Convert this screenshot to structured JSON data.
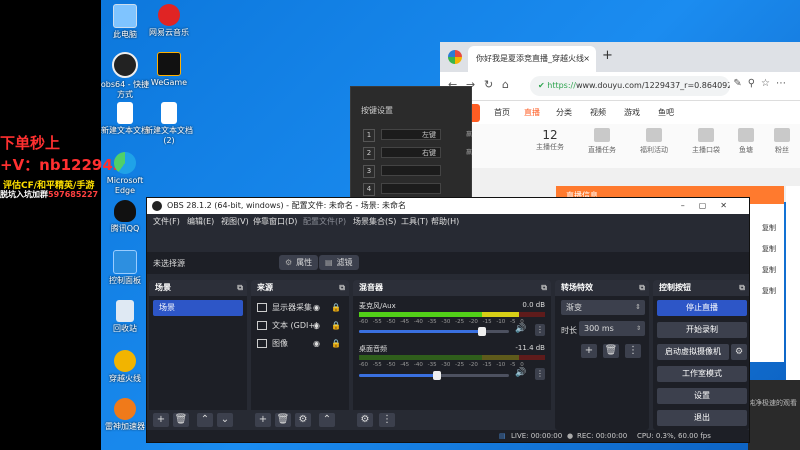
{
  "overlay": {
    "line1": "下单秒上",
    "line2": "+V：nb122943",
    "line3": "评估CF/和平精英/手游",
    "line4_a": "脱坑入坑加群",
    "line4_b": "597685227"
  },
  "desktop_icons": [
    {
      "label": "此电脑",
      "icon": "computer-icon"
    },
    {
      "label": "网易云音乐",
      "icon": "netease-music-icon"
    },
    {
      "label": "obs64 - 快捷方式",
      "icon": "obs-icon"
    },
    {
      "label": "WeGame",
      "icon": "wegame-icon"
    },
    {
      "label": "新建文本文档",
      "icon": "text-file-icon"
    },
    {
      "label": "新建文本文档 (2)",
      "icon": "text-file-icon"
    },
    {
      "label": "Microsoft Edge",
      "icon": "edge-icon"
    },
    {
      "label": "腾讯QQ",
      "icon": "qq-icon"
    },
    {
      "label": "控制面板",
      "icon": "control-panel-icon"
    },
    {
      "label": "回收站",
      "icon": "recycle-bin-icon"
    },
    {
      "label": "穿越火线",
      "icon": "crossfire-icon"
    },
    {
      "label": "雷神加速器",
      "icon": "leishen-icon"
    }
  ],
  "browser": {
    "tab_title": "你好我是夏添竞直播_穿越火线",
    "url_secure": "https://",
    "url_rest": "www.douyu.com/1229437_r=0.86409230",
    "site_logo": "斗鱼",
    "site_nav": [
      "首页",
      "直播",
      "分类",
      "视频",
      "游戏",
      "鱼吧"
    ],
    "active_nav": "直播",
    "icons": [
      {
        "label": "主播任务",
        "num": "12"
      },
      {
        "label": "直播任务",
        "num": ""
      },
      {
        "label": "福利活动",
        "num": ""
      },
      {
        "label": "主播口袋",
        "num": ""
      },
      {
        "label": "鱼塘",
        "num": ""
      },
      {
        "label": "粉丝",
        "num": ""
      }
    ],
    "popup_title": "直播信息",
    "popup_side": [
      "复制",
      "复制",
      "复制",
      "复制"
    ]
  },
  "bottom_right_text": "纯净极速的观看",
  "hotkey_dialog": {
    "title": "按键设置",
    "rows": [
      {
        "num": "1",
        "key": "左键",
        "side": "赢"
      },
      {
        "num": "2",
        "key": "右键",
        "side": "赢"
      },
      {
        "num": "3",
        "key": "",
        "side": ""
      },
      {
        "num": "4",
        "key": "",
        "side": ""
      }
    ]
  },
  "obs": {
    "title": "OBS 28.1.2 (64-bit, windows) - 配置文件: 未命名 - 场景: 未命名",
    "menu": [
      "文件(F)",
      "编辑(E)",
      "视图(V)",
      "停靠窗口(D)",
      "配置文件(P)",
      "场景集合(S)",
      "工具(T)",
      "帮助(H)"
    ],
    "no_source": "未选择源",
    "properties_btn": "属性",
    "filters_btn": "滤镜",
    "scenes": {
      "title": "场景",
      "items": [
        "场景"
      ]
    },
    "sources": {
      "title": "来源",
      "items": [
        "显示器采集",
        "文本 (GDI+)",
        "图像"
      ]
    },
    "mixer": {
      "title": "混音器",
      "scale": "-60 -55 -50 -45 -40 -35 -30 -25 -20 -15 -10 -5 0",
      "channels": [
        {
          "name": "麦克风/Aux",
          "db": "0.0 dB",
          "level": 0.82
        },
        {
          "name": "桌面音频",
          "db": "-11.4 dB",
          "level": 0.52
        }
      ]
    },
    "transitions": {
      "title": "转场特效",
      "type": "渐变",
      "duration_label": "时长",
      "duration": "300 ms"
    },
    "controls": {
      "title": "控制按钮",
      "buttons": [
        "停止直播",
        "开始录制",
        "启动虚拟摄像机",
        "工作室模式",
        "设置",
        "退出"
      ]
    },
    "status": {
      "live": "LIVE: 00:00:00",
      "rec": "REC: 00:00:00",
      "cpu": "CPU: 0.3%, 60.00 fps"
    }
  }
}
